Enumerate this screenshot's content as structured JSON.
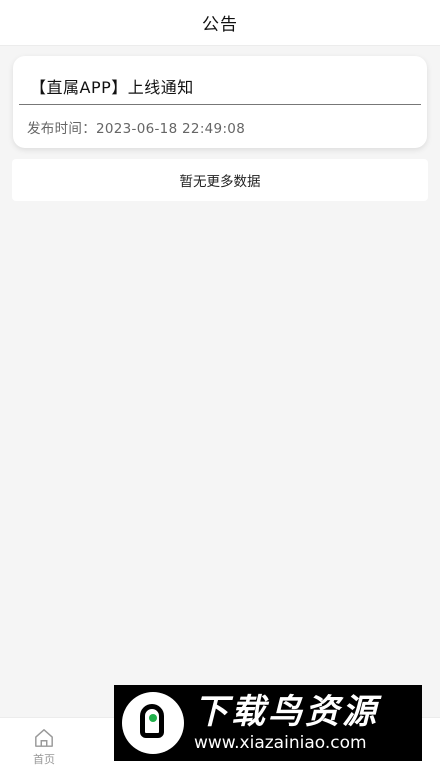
{
  "header": {
    "title": "公告"
  },
  "notices": [
    {
      "title": "【直属APP】上线通知",
      "time": "发布时间：2023-06-18 22:49:08"
    }
  ],
  "list_footer": "暂无更多数据",
  "tabbar": {
    "items": [
      {
        "label": "首页",
        "icon": "home-icon"
      },
      {
        "label": "",
        "icon": "tab-icon"
      },
      {
        "label": "",
        "icon": "tab-icon"
      },
      {
        "label": "",
        "icon": "tab-icon"
      },
      {
        "label": "",
        "icon": "tab-icon"
      }
    ]
  },
  "watermark": {
    "name": "下载鸟资源",
    "url": "www.xiazainiao.com"
  }
}
